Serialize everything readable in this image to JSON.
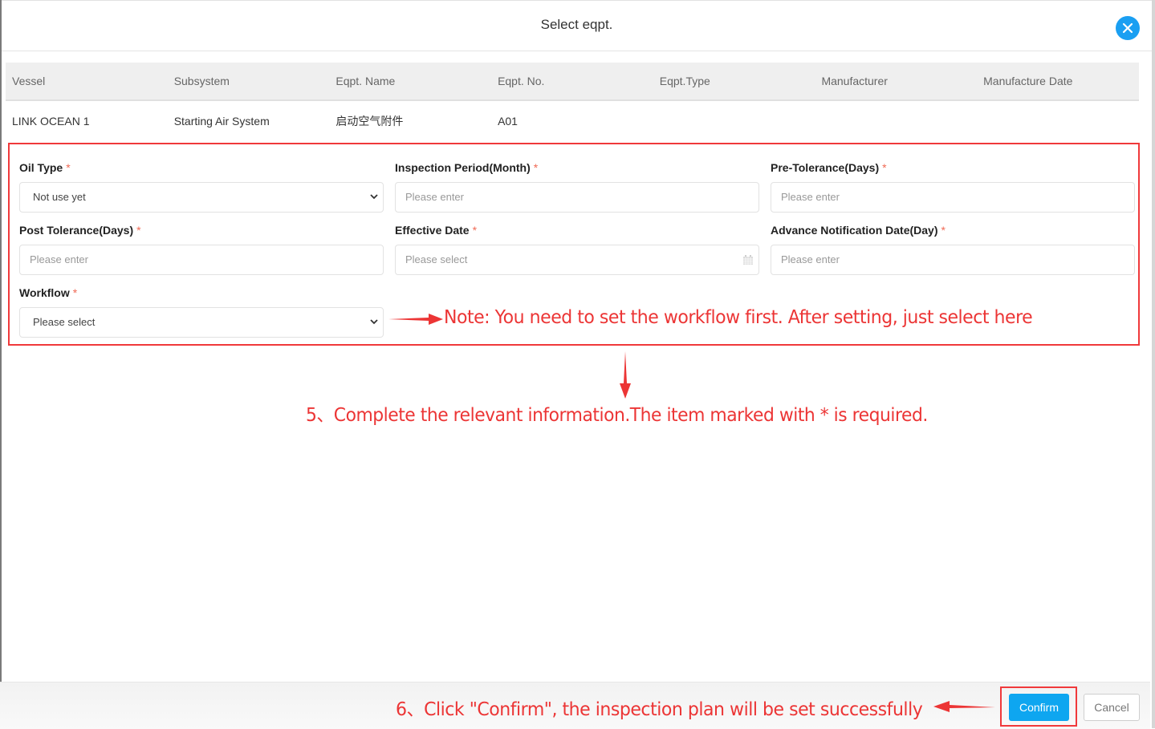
{
  "modal": {
    "title": "Select eqpt.",
    "close_icon": "close-circle-icon"
  },
  "table": {
    "headers": [
      "Vessel",
      "Subsystem",
      "Eqpt. Name",
      "Eqpt. No.",
      "Eqpt.Type",
      "Manufacturer",
      "Manufacture Date"
    ],
    "rows": [
      [
        "LINK OCEAN 1",
        "Starting Air System",
        "启动空气附件",
        "A01",
        "",
        "",
        ""
      ]
    ]
  },
  "form": {
    "required_mark": "*",
    "oil_type": {
      "label": "Oil Type",
      "value": "Not use yet"
    },
    "inspection_period": {
      "label": "Inspection Period(Month)",
      "placeholder": "Please enter"
    },
    "pre_tolerance": {
      "label": "Pre-Tolerance(Days)",
      "placeholder": "Please enter"
    },
    "post_tolerance": {
      "label": "Post Tolerance(Days)",
      "placeholder": "Please enter"
    },
    "effective_date": {
      "label": "Effective Date",
      "placeholder": "Please select"
    },
    "advance_notification": {
      "label": "Advance Notification Date(Day)",
      "placeholder": "Please enter"
    },
    "workflow": {
      "label": "Workflow",
      "value": "Please select"
    }
  },
  "annotations": {
    "workflow_note": "Note: You need to set the workflow first. After setting, just select here",
    "step5": "5、Complete the relevant information.The item marked with * is required.",
    "step6": "6、Click \"Confirm\", the inspection plan will be  set successfully",
    "color": "#ec3535"
  },
  "footer": {
    "confirm_label": "Confirm",
    "cancel_label": "Cancel"
  },
  "colors": {
    "primary": "#0ea6f0",
    "close": "#1a9ff2",
    "highlight": "#f0393b",
    "required": "#f06a55"
  }
}
